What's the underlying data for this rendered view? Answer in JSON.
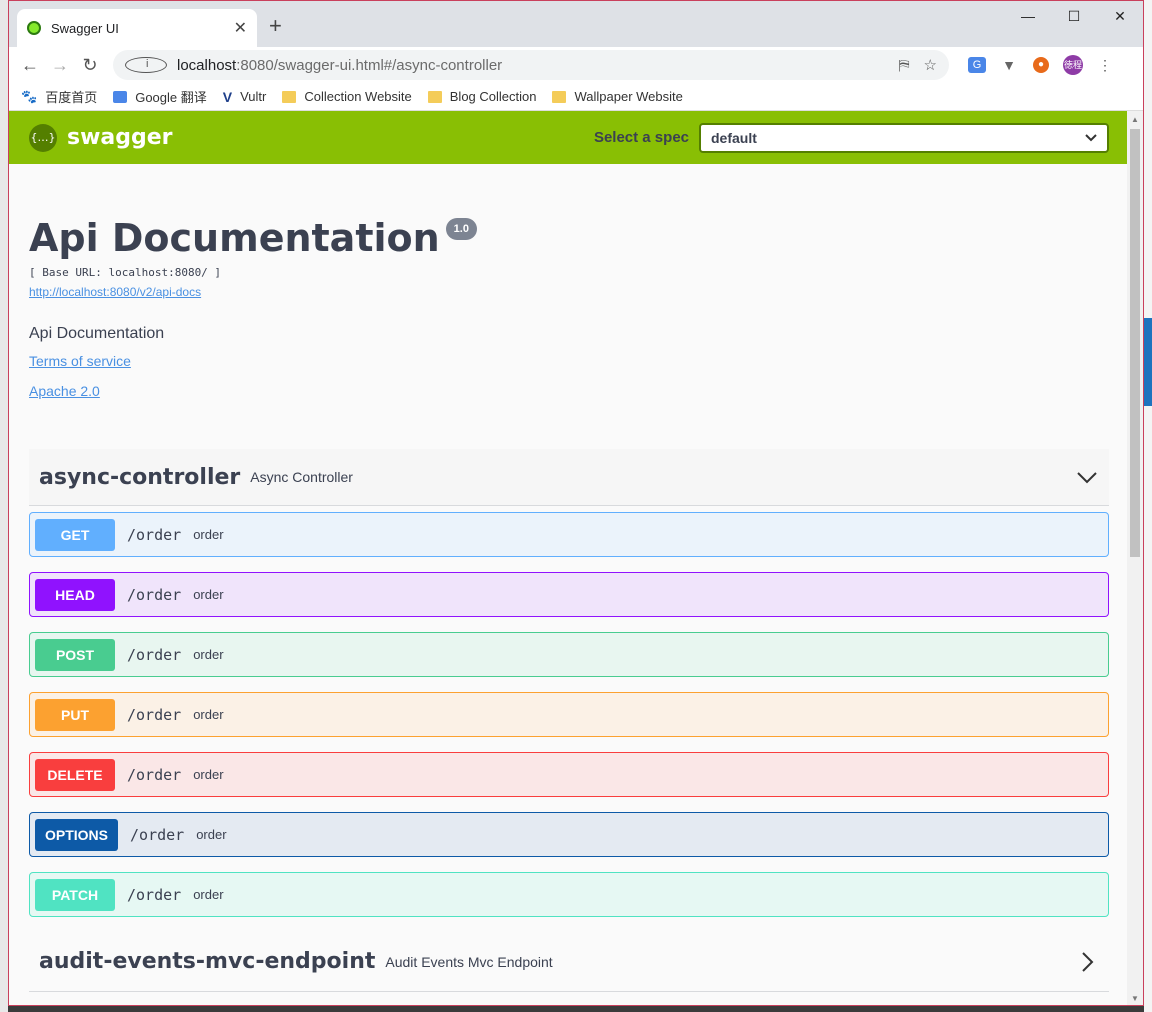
{
  "browser": {
    "tab_title": "Swagger UI",
    "tab_close": "✕",
    "new_tab": "+",
    "window_controls": [
      "—",
      "☐",
      "✕"
    ],
    "url_host": "localhost",
    "url_rest": ":8080/swagger-ui.html#/async-controller",
    "avatar_text": "徳程",
    "bookmarks": [
      {
        "label": "百度首页",
        "icon": "paw-icon"
      },
      {
        "label": "Google 翻译",
        "icon": "google-translate-icon"
      },
      {
        "label": "Vultr",
        "icon": "vultr-icon"
      },
      {
        "label": "Collection Website",
        "icon": "folder-icon"
      },
      {
        "label": "Blog Collection",
        "icon": "folder-icon"
      },
      {
        "label": "Wallpaper Website",
        "icon": "folder-icon"
      }
    ]
  },
  "swagger": {
    "logo_text": "swagger",
    "select_label": "Select a spec",
    "select_value": "default",
    "title": "Api Documentation",
    "version": "1.0",
    "base_url": "[ Base URL: localhost:8080/ ]",
    "api_docs_link": "http://localhost:8080/v2/api-docs",
    "description": "Api Documentation",
    "terms": "Terms of service",
    "license": "Apache 2.0",
    "tags": [
      {
        "name": "async-controller",
        "description": "Async Controller",
        "expanded": true
      },
      {
        "name": "audit-events-mvc-endpoint",
        "description": "Audit Events Mvc Endpoint",
        "expanded": false
      }
    ],
    "operations": [
      {
        "method": "GET",
        "path": "/order",
        "summary": "order",
        "color": "#61affe",
        "bg": "#ebf3fb"
      },
      {
        "method": "HEAD",
        "path": "/order",
        "summary": "order",
        "color": "#9012fe",
        "bg": "#f0e4fb"
      },
      {
        "method": "POST",
        "path": "/order",
        "summary": "order",
        "color": "#49cc90",
        "bg": "#e8f6f0"
      },
      {
        "method": "PUT",
        "path": "/order",
        "summary": "order",
        "color": "#fca130",
        "bg": "#fbf1e6"
      },
      {
        "method": "DELETE",
        "path": "/order",
        "summary": "order",
        "color": "#f93e3e",
        "bg": "#fae7e7"
      },
      {
        "method": "OPTIONS",
        "path": "/order",
        "summary": "order",
        "color": "#0d5aa7",
        "bg": "#e4eaf2"
      },
      {
        "method": "PATCH",
        "path": "/order",
        "summary": "order",
        "color": "#50e3c2",
        "bg": "#e6f8f3"
      }
    ]
  }
}
